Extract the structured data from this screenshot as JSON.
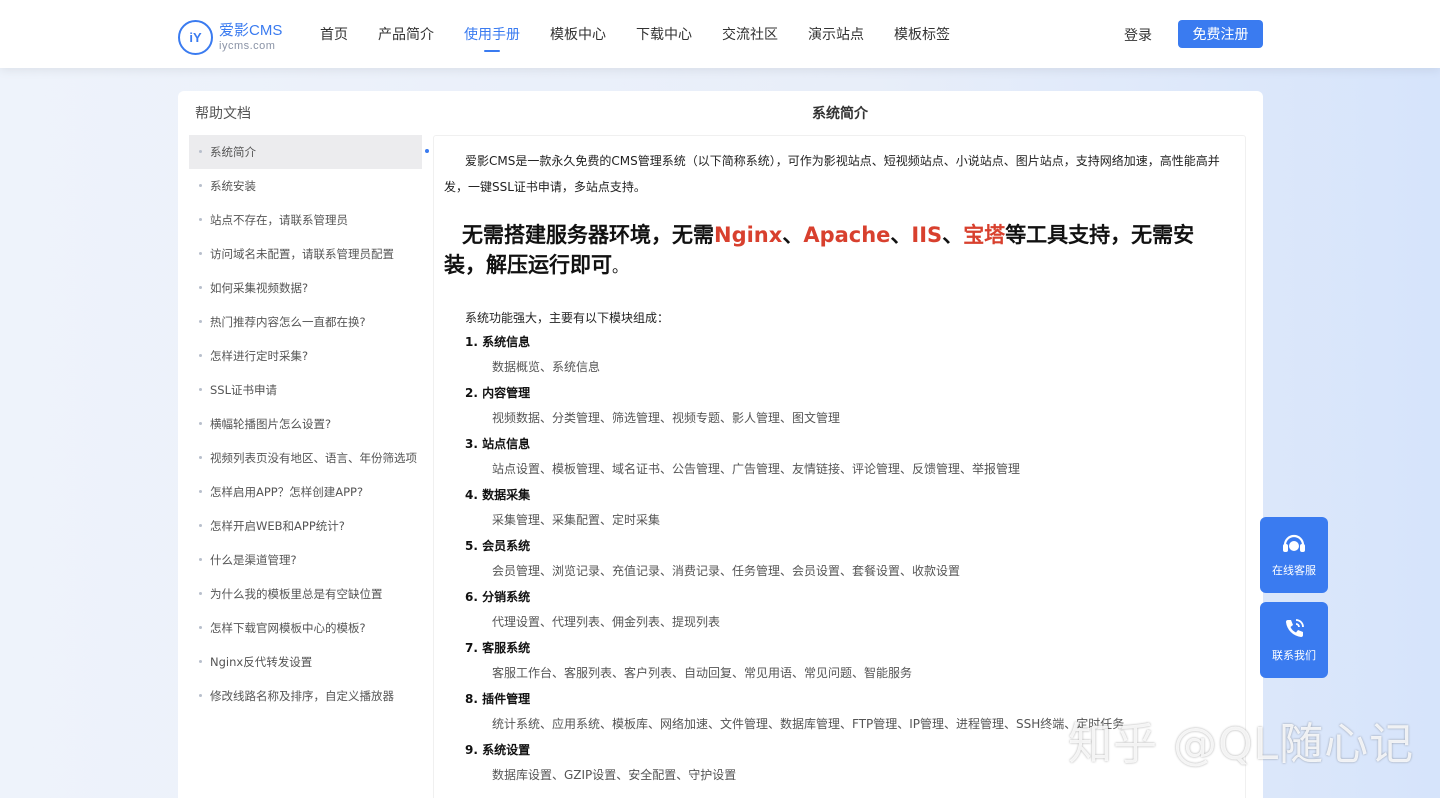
{
  "brand": {
    "logo_mark": "iY",
    "name": "爱影CMS",
    "domain": "iycms.com",
    "accent": "#3a7bf0"
  },
  "nav": {
    "items": [
      {
        "label": "首页",
        "active": false
      },
      {
        "label": "产品简介",
        "active": false
      },
      {
        "label": "使用手册",
        "active": true
      },
      {
        "label": "模板中心",
        "active": false
      },
      {
        "label": "下载中心",
        "active": false
      },
      {
        "label": "交流社区",
        "active": false
      },
      {
        "label": "演示站点",
        "active": false
      },
      {
        "label": "模板标签",
        "active": false
      }
    ],
    "login": "登录",
    "register": "免费注册"
  },
  "sidebar": {
    "title": "帮助文档",
    "items": [
      {
        "label": "系统简介",
        "active": true
      },
      {
        "label": "系统安装"
      },
      {
        "label": "站点不存在，请联系管理员"
      },
      {
        "label": "访问域名未配置，请联系管理员配置"
      },
      {
        "label": "如何采集视频数据?"
      },
      {
        "label": "热门推荐内容怎么一直都在换?"
      },
      {
        "label": "怎样进行定时采集?"
      },
      {
        "label": "SSL证书申请"
      },
      {
        "label": "横幅轮播图片怎么设置?"
      },
      {
        "label": "视频列表页没有地区、语言、年份筛选项"
      },
      {
        "label": "怎样启用APP？怎样创建APP?"
      },
      {
        "label": "怎样开启WEB和APP统计?"
      },
      {
        "label": "什么是渠道管理?"
      },
      {
        "label": "为什么我的模板里总是有空缺位置"
      },
      {
        "label": "怎样下载官网模板中心的模板?"
      },
      {
        "label": "Nginx反代转发设置"
      },
      {
        "label": "修改线路名称及排序，自定义播放器"
      }
    ]
  },
  "content": {
    "title": "系统简介",
    "intro": "爱影CMS是一款永久免费的CMS管理系统（以下简称系统），可作为影视站点、短视频站点、小说站点、图片站点，支持网络加速，高性能高并发，一键SSL证书申请，多站点支持。",
    "headline": {
      "part1": "无需搭建服务器环境，无需",
      "nginx": "Nginx",
      "sep1": "、",
      "apache": "Apache",
      "sep2": "、",
      "iis": "IIS",
      "sep3": "、",
      "baota": "宝塔",
      "part2": "等工具支持，无需安装，解压运行即可",
      "end": "。"
    },
    "features_intro": "系统功能强大，主要有以下模块组成：",
    "modules": [
      {
        "title": "1. 系统信息",
        "desc": "数据概览、系统信息"
      },
      {
        "title": "2. 内容管理",
        "desc": "视频数据、分类管理、筛选管理、视频专题、影人管理、图文管理"
      },
      {
        "title": "3. 站点信息",
        "desc": "站点设置、模板管理、域名证书、公告管理、广告管理、友情链接、评论管理、反馈管理、举报管理"
      },
      {
        "title": "4. 数据采集",
        "desc": "采集管理、采集配置、定时采集"
      },
      {
        "title": "5. 会员系统",
        "desc": "会员管理、浏览记录、充值记录、消费记录、任务管理、会员设置、套餐设置、收款设置"
      },
      {
        "title": "6. 分销系统",
        "desc": "代理设置、代理列表、佣金列表、提现列表"
      },
      {
        "title": "7. 客服系统",
        "desc": "客服工作台、客服列表、客户列表、自动回复、常见用语、常见问题、智能服务"
      },
      {
        "title": "8. 插件管理",
        "desc": "统计系统、应用系统、模板库、网络加速、文件管理、数据库管理、FTP管理、IP管理、进程管理、SSH终端、定时任务"
      },
      {
        "title": "9. 系统设置",
        "desc": "数据库设置、GZIP设置、安全配置、守护设置"
      }
    ]
  },
  "float": {
    "service": "在线客服",
    "contact": "联系我们"
  },
  "watermark": "知乎 @QL随心记"
}
